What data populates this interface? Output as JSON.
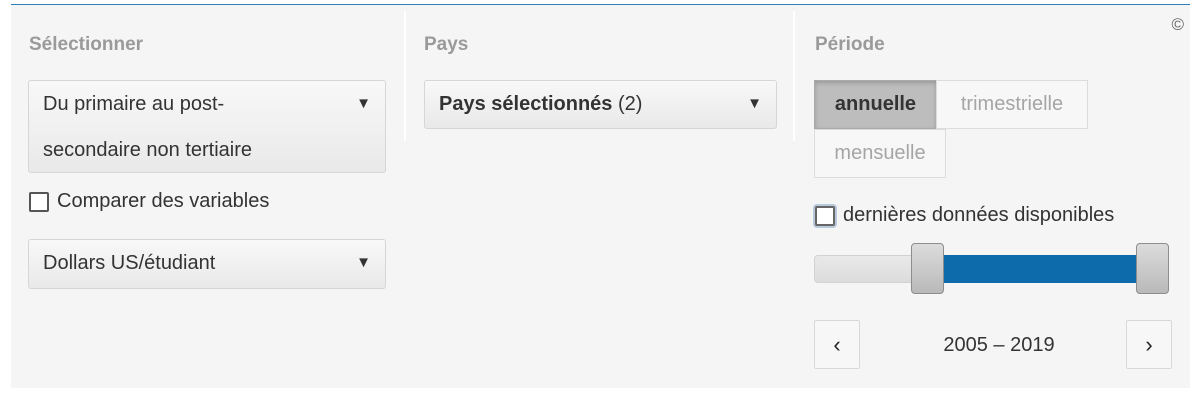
{
  "copyright": "©",
  "select_column": {
    "heading": "Sélectionner",
    "indicator": {
      "line1": "Du primaire au post-",
      "line2": "secondaire non tertiaire"
    },
    "compare_label": "Comparer des variables",
    "unit": "Dollars US/étudiant"
  },
  "country_column": {
    "heading": "Pays",
    "select_bold": "Pays sélectionnés",
    "select_count": " (2)"
  },
  "period_column": {
    "heading": "Période",
    "frequency": {
      "annual": "annuelle",
      "quarterly": "trimestrielle",
      "monthly": "mensuelle",
      "selected": "annuelle"
    },
    "latest_label": "dernières données disponibles",
    "range_label": "2005 – 2019",
    "range": {
      "min_year": 1999,
      "start_year": 2005,
      "end_year": 2019
    }
  },
  "icons": {
    "dropdown": "▼",
    "prev": "‹",
    "next": "›"
  }
}
